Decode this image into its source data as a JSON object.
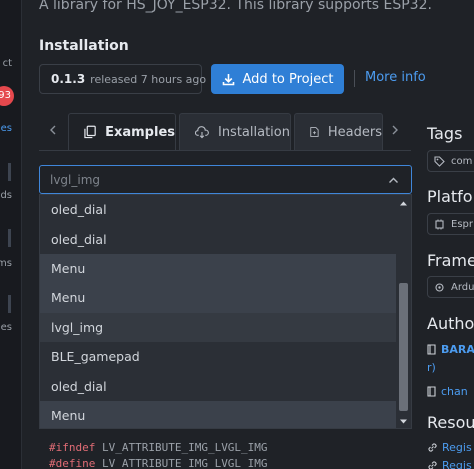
{
  "sidebar": {
    "labels": [
      "ct",
      "ies",
      "ds",
      "rms",
      "es"
    ],
    "badge_count": "93"
  },
  "library": {
    "description": "A library for HS_JOY_ESP32. This library supports ESP32."
  },
  "installation": {
    "title": "Installation",
    "version": "0.1.3",
    "released": "released 7 hours ago",
    "add_button": "Add to Project",
    "separator": "|",
    "more_info": "More info"
  },
  "tabs": [
    {
      "label": "Examples",
      "icon": "copy-icon",
      "active": true
    },
    {
      "label": "Installation",
      "icon": "download-cloud-icon",
      "active": false
    },
    {
      "label": "Headers",
      "icon": "file-icon",
      "active": false
    }
  ],
  "example_select": {
    "value": "lvgl_img",
    "options": [
      "oled_dial",
      "oled_dial",
      "Menu",
      "Menu",
      "lvgl_img",
      "BLE_gamepad",
      "oled_dial",
      "Menu"
    ],
    "selected_index": 4,
    "hovered_indices": [
      2,
      3,
      7
    ]
  },
  "code": {
    "line1_kw": "#ifndef",
    "line1_rest": " LV_ATTRIBUTE_IMG_LVGL_IMG",
    "line2_kw": "#define",
    "line2_rest": " LV_ATTRIBUTE_IMG_LVGL_IMG"
  },
  "right_panel": {
    "tags_title": "Tags",
    "tag_chip": "com",
    "platforms_title": "Platfo",
    "platform_chip": "Espr",
    "frameworks_title": "Frame",
    "framework_chip": "Ardu",
    "authors_title": "Autho",
    "author_name": "BARA",
    "author_suffix": "r)",
    "changelog_link": "chan",
    "resources_title": "Resou",
    "registry_link": "Regis",
    "registry_link_2": "Regis"
  },
  "colors": {
    "accent": "#2f7fd6",
    "link": "#4c9cf0",
    "badge": "#e5484d",
    "background": "#1f2227",
    "dropdown_bg": "#2b2f36"
  }
}
